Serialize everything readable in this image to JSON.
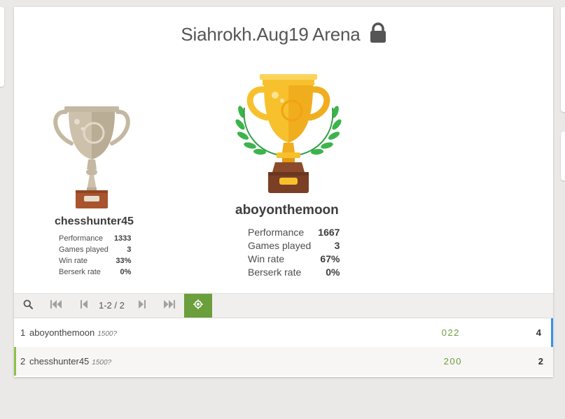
{
  "tournament": {
    "title": "Siahrokh.Aug19 Arena"
  },
  "podium": {
    "first": {
      "name": "aboyonthemoon",
      "stats": [
        {
          "label": "Performance",
          "value": "1667"
        },
        {
          "label": "Games played",
          "value": "3"
        },
        {
          "label": "Win rate",
          "value": "67%"
        },
        {
          "label": "Berserk rate",
          "value": "0%"
        }
      ]
    },
    "second": {
      "name": "chesshunter45",
      "stats": [
        {
          "label": "Performance",
          "value": "1333"
        },
        {
          "label": "Games played",
          "value": "3"
        },
        {
          "label": "Win rate",
          "value": "33%"
        },
        {
          "label": "Berserk rate",
          "value": "0%"
        }
      ]
    }
  },
  "pager": {
    "pages": "1-2 / 2"
  },
  "standings": [
    {
      "rank": "1",
      "name": "aboyonthemoon",
      "rating": "1500?",
      "sheet": "022",
      "score": "4"
    },
    {
      "rank": "2",
      "name": "chesshunter45",
      "rating": "1500?",
      "sheet": "200",
      "score": "2"
    }
  ],
  "colors": {
    "accent_green": "#6a9f3b",
    "row_highlight_blue": "#3692e7",
    "gold": "#f7c12e",
    "silver": "#cbbfa9"
  }
}
